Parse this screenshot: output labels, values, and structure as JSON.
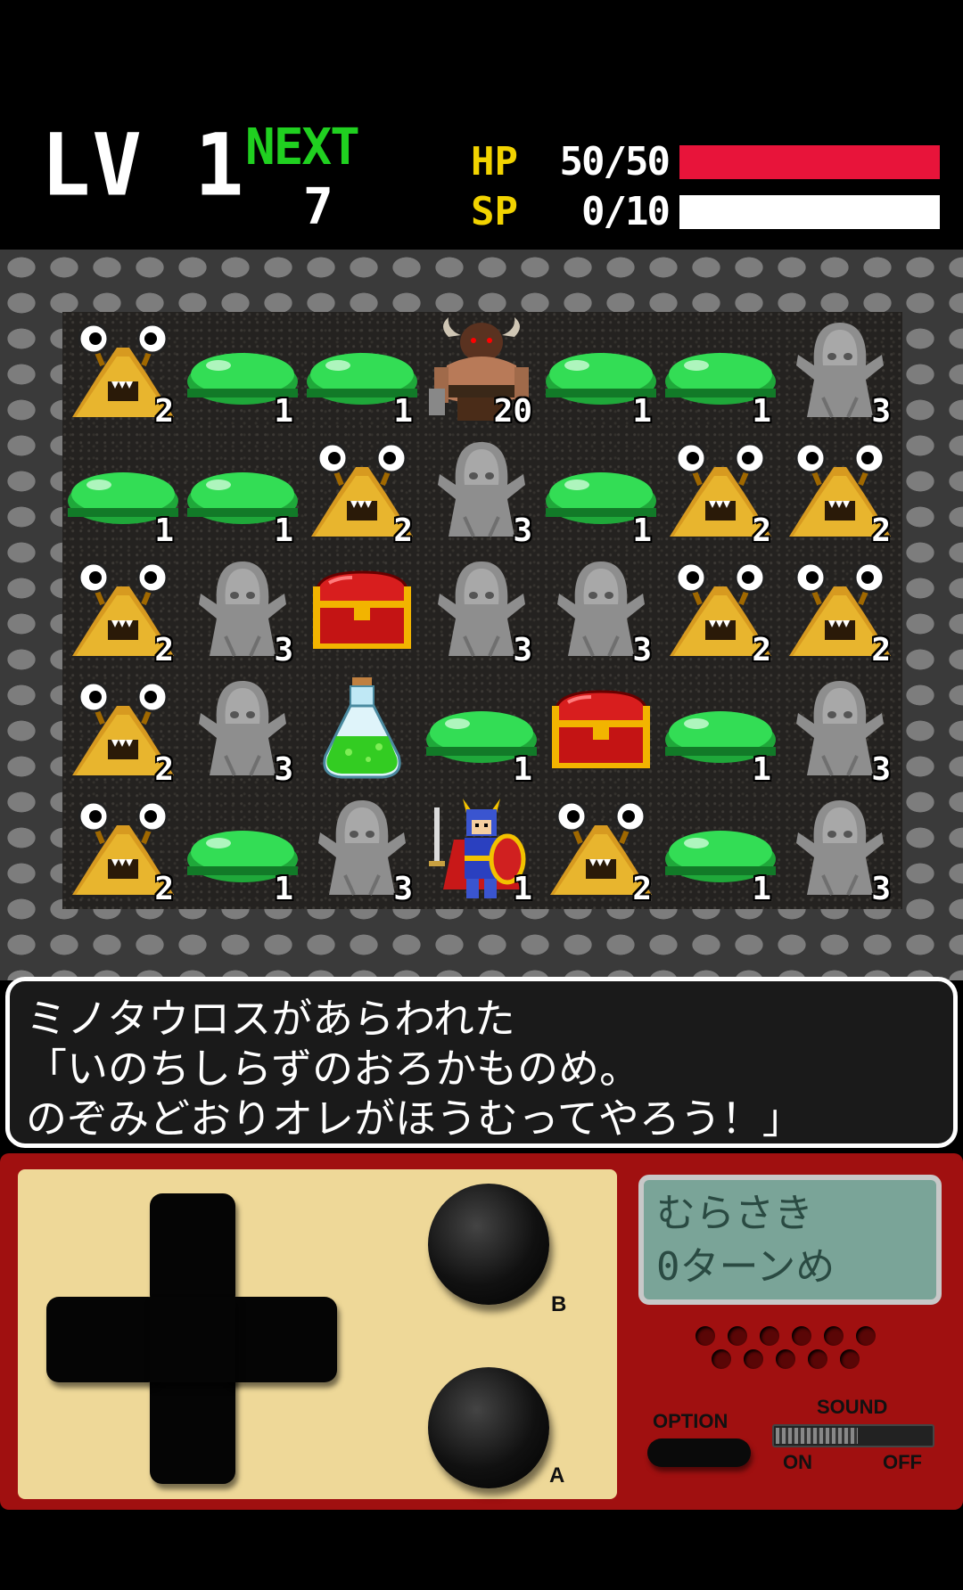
{
  "hud": {
    "level": "LV 1",
    "next_label": "NEXT",
    "next_value": "7",
    "hp_label": "HP",
    "hp_value": "50/50",
    "hp_fraction": 1.0,
    "sp_label": "SP",
    "sp_value": "0/10",
    "sp_fraction": 0.0,
    "colors": {
      "hp_bar": "#e8143a",
      "sp_bar": "#ffffff",
      "next_label": "#20d020",
      "stat_label": "#f2d300"
    }
  },
  "board": {
    "rows": [
      [
        {
          "type": "slug",
          "n": "2"
        },
        {
          "type": "slime",
          "n": "1"
        },
        {
          "type": "slime",
          "n": "1"
        },
        {
          "type": "minotaur",
          "n": "20"
        },
        {
          "type": "slime",
          "n": "1"
        },
        {
          "type": "slime",
          "n": "1"
        },
        {
          "type": "ghost",
          "n": "3"
        }
      ],
      [
        {
          "type": "slime",
          "n": "1"
        },
        {
          "type": "slime",
          "n": "1"
        },
        {
          "type": "slug",
          "n": "2"
        },
        {
          "type": "ghost",
          "n": "3"
        },
        {
          "type": "slime",
          "n": "1"
        },
        {
          "type": "slug",
          "n": "2"
        },
        {
          "type": "slug",
          "n": "2"
        }
      ],
      [
        {
          "type": "slug",
          "n": "2"
        },
        {
          "type": "ghost",
          "n": "3"
        },
        {
          "type": "chest",
          "n": ""
        },
        {
          "type": "ghost",
          "n": "3"
        },
        {
          "type": "ghost",
          "n": "3"
        },
        {
          "type": "slug",
          "n": "2"
        },
        {
          "type": "slug",
          "n": "2"
        }
      ],
      [
        {
          "type": "slug",
          "n": "2"
        },
        {
          "type": "ghost",
          "n": "3"
        },
        {
          "type": "potion",
          "n": ""
        },
        {
          "type": "slime",
          "n": "1"
        },
        {
          "type": "chest",
          "n": ""
        },
        {
          "type": "slime",
          "n": "1"
        },
        {
          "type": "ghost",
          "n": "3"
        }
      ],
      [
        {
          "type": "slug",
          "n": "2"
        },
        {
          "type": "slime",
          "n": "1"
        },
        {
          "type": "ghost",
          "n": "3"
        },
        {
          "type": "hero",
          "n": "1"
        },
        {
          "type": "slug",
          "n": "2"
        },
        {
          "type": "slime",
          "n": "1"
        },
        {
          "type": "ghost",
          "n": "3"
        }
      ]
    ]
  },
  "message": {
    "lines": [
      "ミノタウロスがあらわれた",
      "「いのちしらずのおろかものめ。",
      "のぞみどおりオレがほうむってやろう！」"
    ]
  },
  "console": {
    "button_b": "B",
    "button_a": "A",
    "lcd_line1": "むらさき",
    "lcd_line2": "0ターンめ",
    "option_label": "OPTION",
    "sound_label": "SOUND",
    "sound_on": "ON",
    "sound_off": "OFF"
  }
}
